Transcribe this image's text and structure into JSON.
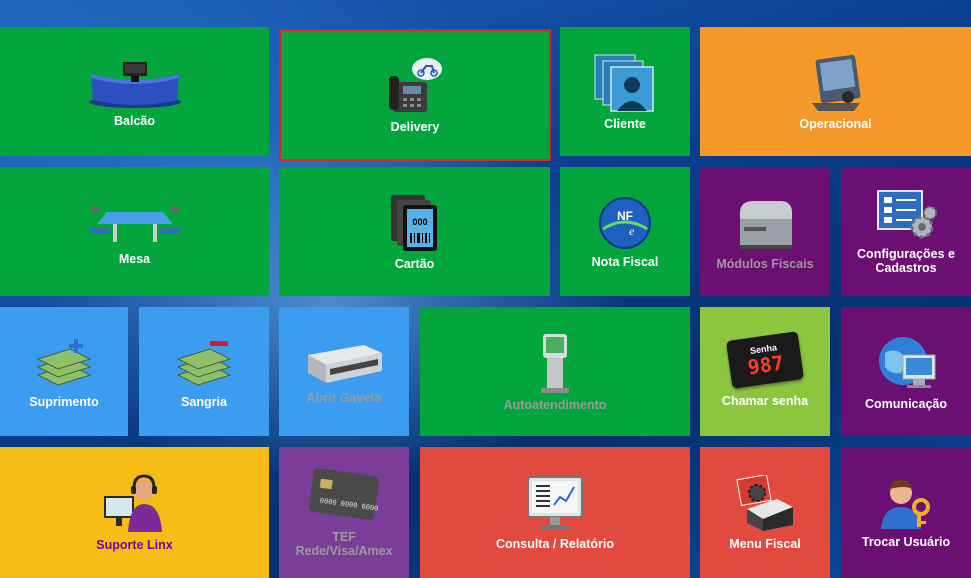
{
  "tiles": {
    "balcao": {
      "label": "Balcão",
      "icon": "counter-icon"
    },
    "delivery": {
      "label": "Delivery",
      "icon": "delivery-phone-icon"
    },
    "cliente": {
      "label": "Cliente",
      "icon": "client-icon"
    },
    "operacional": {
      "label": "Operacional",
      "icon": "control-panel-icon"
    },
    "mesa": {
      "label": "Mesa",
      "icon": "table-icon"
    },
    "cartao": {
      "label": "Cartão",
      "icon": "card-icon"
    },
    "nota_fiscal": {
      "label": "Nota Fiscal",
      "icon": "nfe-icon"
    },
    "modulos_fiscais": {
      "label": "Módulos Fiscais",
      "icon": "printer-icon"
    },
    "configuracoes": {
      "label": "Configurações e Cadastros",
      "icon": "settings-icon"
    },
    "suprimento": {
      "label": "Suprimento",
      "icon": "money-plus-icon"
    },
    "sangria": {
      "label": "Sangria",
      "icon": "money-minus-icon"
    },
    "abrir_gaveta": {
      "label": "Abrir Gaveta",
      "icon": "cash-drawer-icon"
    },
    "autoatendimento": {
      "label": "Autoatendimento",
      "icon": "kiosk-icon"
    },
    "chamar_senha": {
      "label": "Chamar senha",
      "icon": "queue-display-icon",
      "display_title": "Senha",
      "display_number": "987"
    },
    "comunicacao": {
      "label": "Comunicação",
      "icon": "globe-monitor-icon"
    },
    "suporte_linx": {
      "label": "Suporte Linx",
      "icon": "support-agent-icon"
    },
    "tef": {
      "label_line1": "TEF",
      "label_line2": "Rede/Visa/Amex",
      "icon": "credit-card-icon"
    },
    "consulta": {
      "label": "Consulta / Relatório",
      "icon": "report-monitor-icon"
    },
    "menu_fiscal": {
      "label": "Menu Fiscal",
      "icon": "fiscal-printer-icon"
    },
    "trocar_usuario": {
      "label": "Trocar Usuário",
      "icon": "user-key-icon"
    }
  },
  "colors": {
    "green": "#03a63c",
    "orange": "#f4992a",
    "purple": "#6b0f73",
    "blue": "#3c9cf0",
    "lime": "#8cc63f",
    "yellow": "#f6bd16",
    "red": "#e34a3f",
    "violet": "#7a3d98",
    "selection": "#e0202a"
  }
}
